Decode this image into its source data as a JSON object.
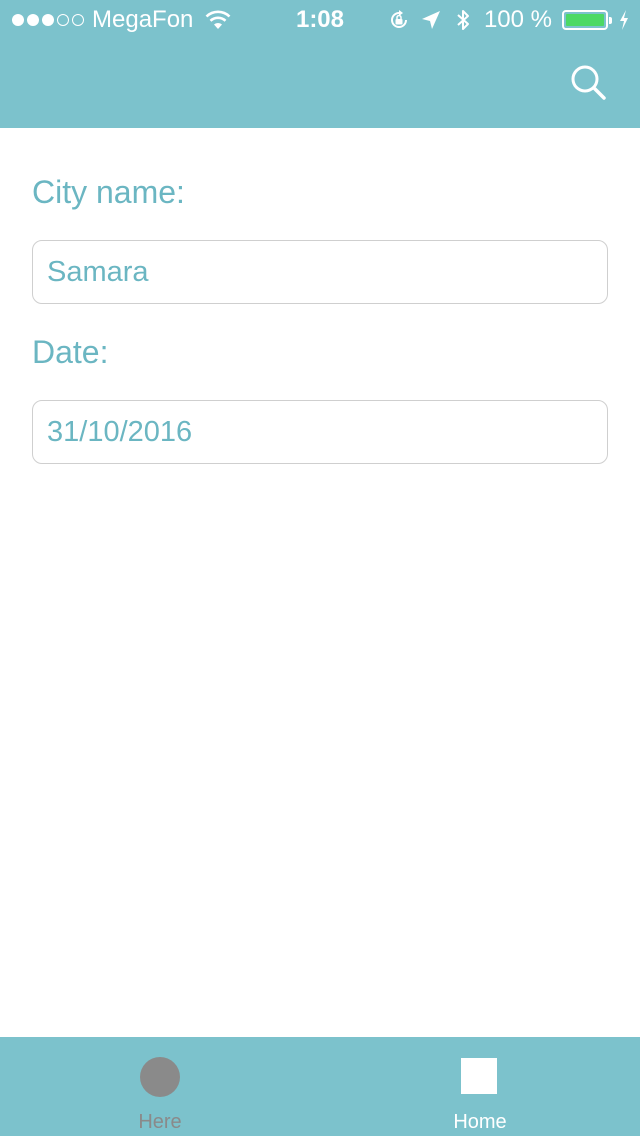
{
  "status_bar": {
    "signal": {
      "filled": 3,
      "total": 5
    },
    "carrier": "MegaFon",
    "time": "1:08",
    "battery_percent_text": "100 %",
    "battery_level": 1.0,
    "battery_color": "#4cd964",
    "icons": [
      "wifi-icon",
      "rotation-lock-icon",
      "location-arrow-icon",
      "bluetooth-icon",
      "battery-icon",
      "charging-bolt-icon"
    ]
  },
  "nav": {
    "background": "#7cc2cc",
    "search_icon": "search-icon"
  },
  "form": {
    "city_label": "City name:",
    "city_value": "Samara",
    "date_label": "Date:",
    "date_value": "31/10/2016",
    "text_color": "#6bb6c2"
  },
  "tabbar": {
    "background": "#7cc2cc",
    "tabs": [
      {
        "label": "Here",
        "icon": "circle-icon",
        "selected": false
      },
      {
        "label": "Home",
        "icon": "square-icon",
        "selected": true
      }
    ]
  }
}
